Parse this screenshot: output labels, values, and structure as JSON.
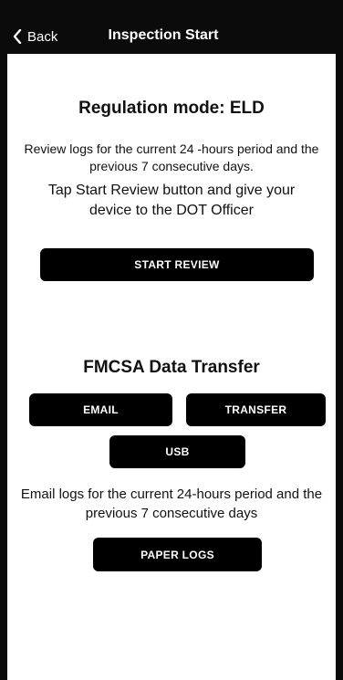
{
  "header": {
    "back_label": "Back",
    "title": "Inspection Start"
  },
  "review": {
    "title": "Regulation mode: ELD",
    "description": "Review logs for the current 24 -hours period and the previous 7 consecutive days.",
    "instruction": "Tap Start Review button and give your device to the DOT Officer",
    "start_button": "START REVIEW"
  },
  "transfer": {
    "title": "FMCSA Data Transfer",
    "email_button": "EMAIL",
    "transfer_button": "TRANSFER",
    "usb_button": "USB",
    "description": "Email logs for the current 24-hours period and the previous 7 consecutive days",
    "paper_logs_button": "PAPER LOGS"
  },
  "colors": {
    "background": "#0b0b0b",
    "content": "#ffffff",
    "button": "#000000"
  },
  "icons": {
    "back": "chevron-left-icon"
  }
}
